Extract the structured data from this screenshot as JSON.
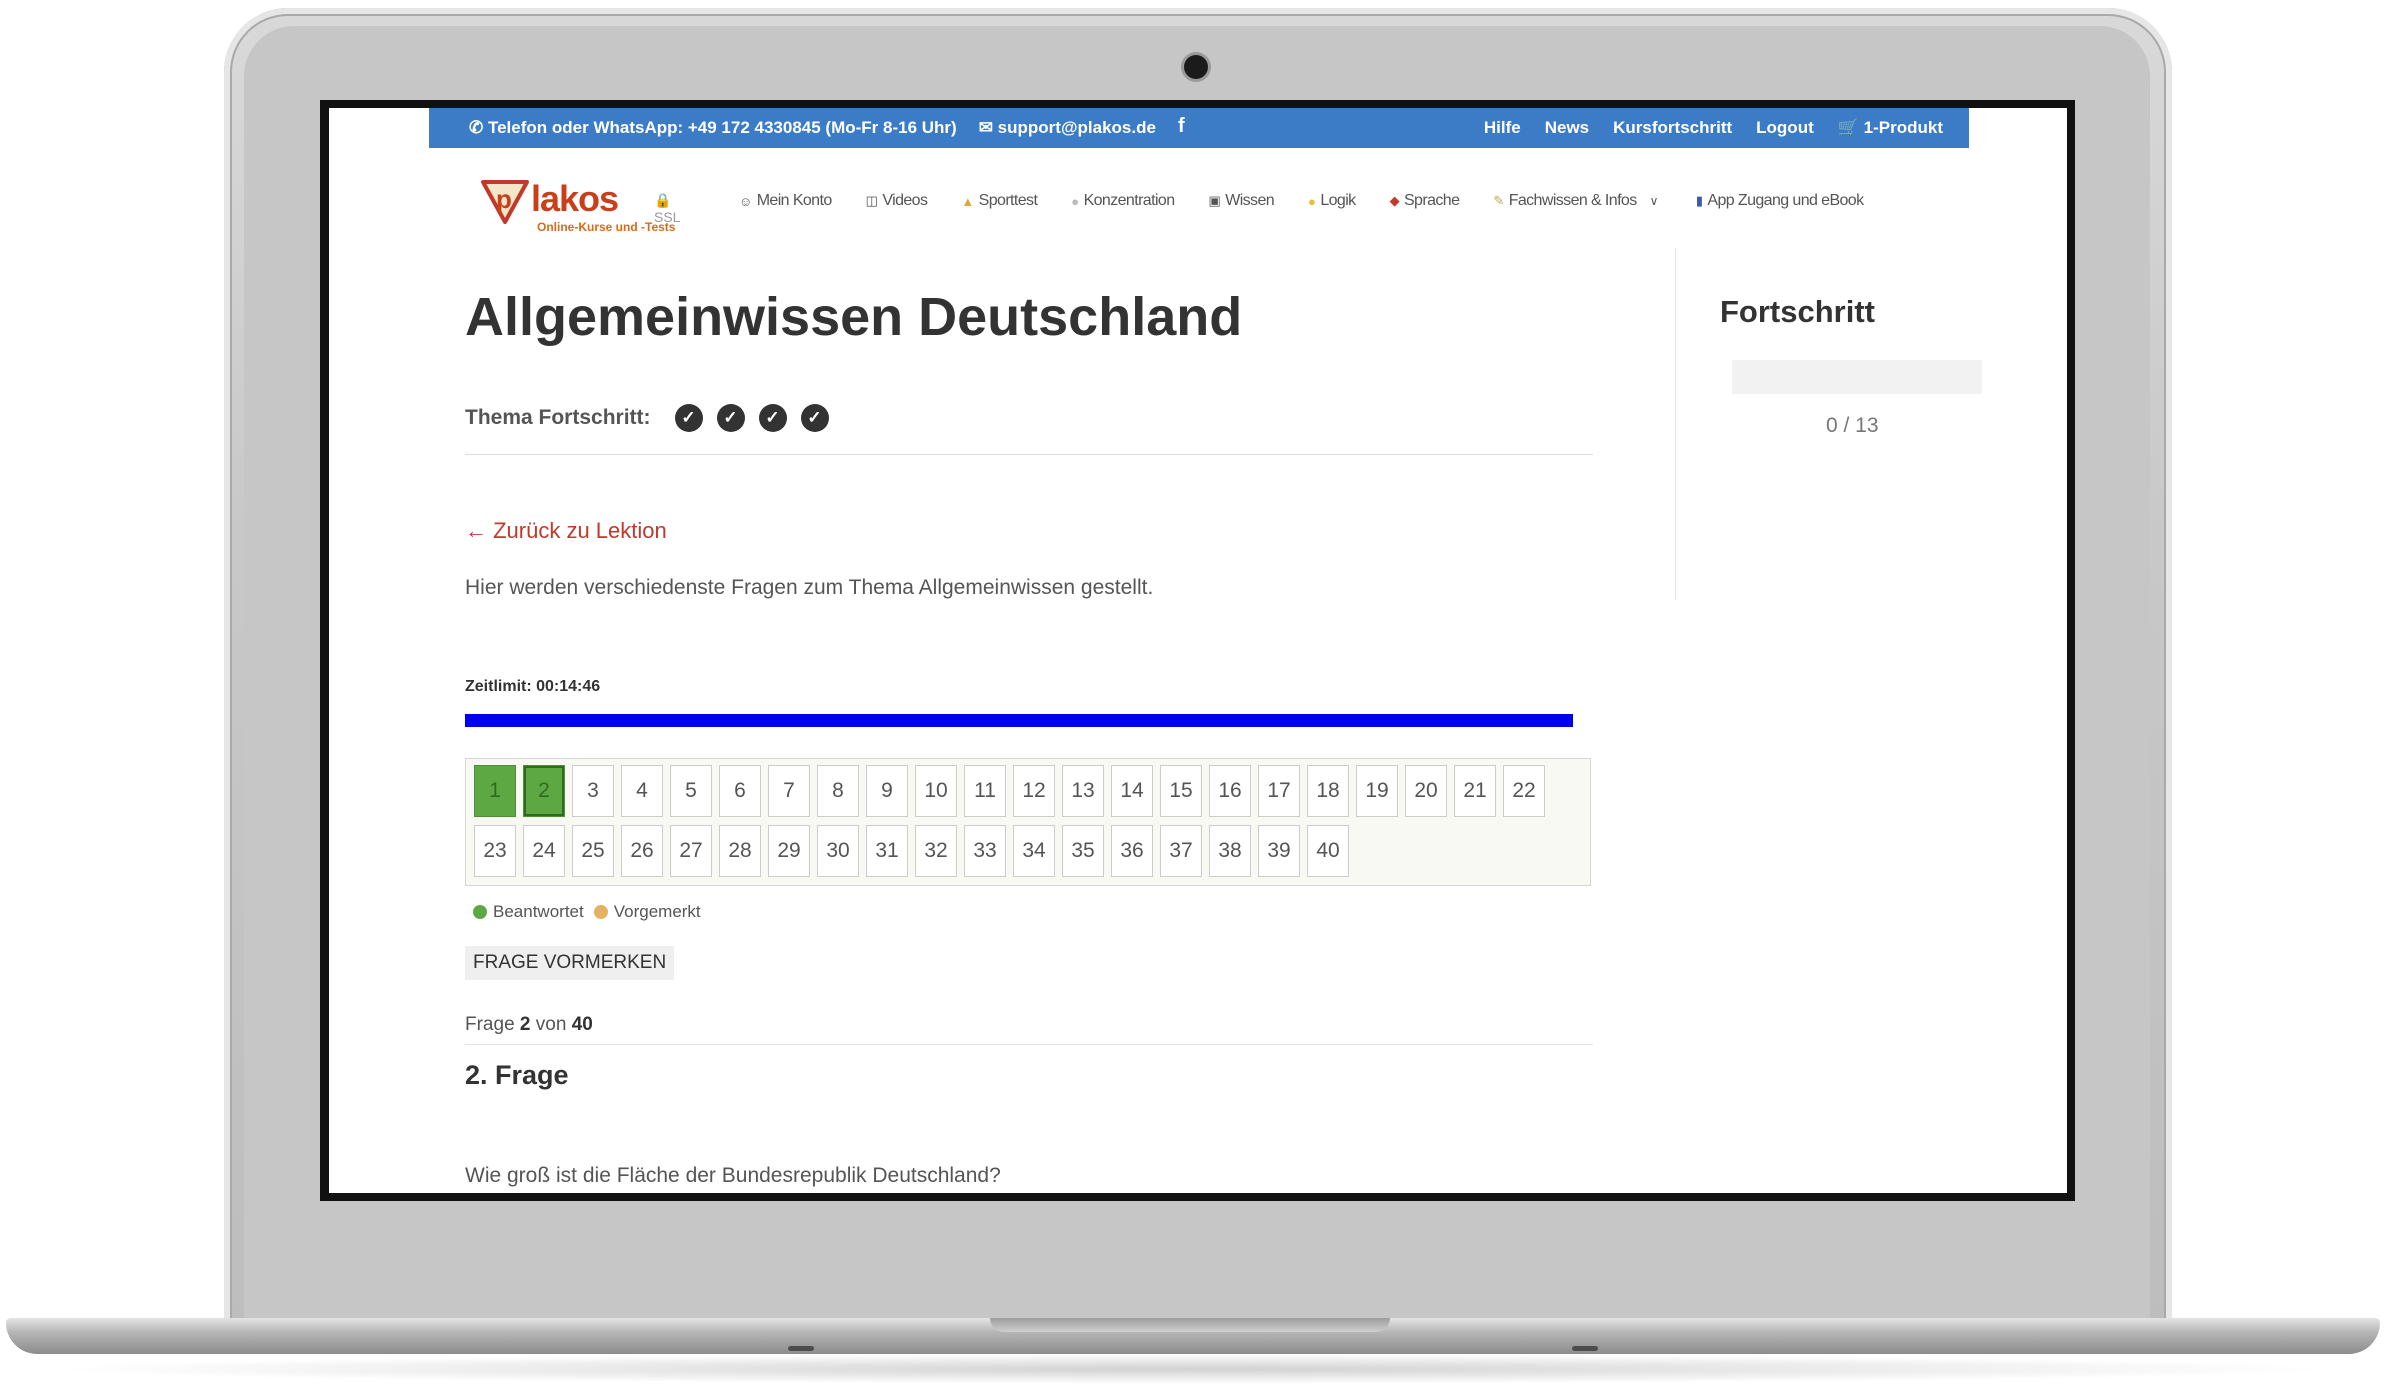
{
  "topbar": {
    "phone": "Telefon oder WhatsApp: +49 172 4330845 (Mo-Fr 8-16 Uhr)",
    "email": "support@plakos.de",
    "links": [
      "Hilfe",
      "News",
      "Kursfortschritt",
      "Logout",
      "1-Produkt"
    ]
  },
  "logo": {
    "word": "lakos",
    "ssl": "SSL",
    "tagline": "Online-Kurse und -Tests"
  },
  "nav": [
    {
      "label": "Mein Konto",
      "icon": "smiley-icon"
    },
    {
      "label": "Videos",
      "icon": "camera-icon"
    },
    {
      "label": "Sporttest",
      "icon": "muscle-icon"
    },
    {
      "label": "Konzentration",
      "icon": "speech-icon"
    },
    {
      "label": "Wissen",
      "icon": "book-icon"
    },
    {
      "label": "Logik",
      "icon": "bulb-icon"
    },
    {
      "label": "Sprache",
      "icon": "lips-icon"
    },
    {
      "label": "Fachwissen & Infos",
      "icon": "notepad-icon"
    },
    {
      "label": "App Zugang und eBook",
      "icon": "phone-icon"
    }
  ],
  "page": {
    "title": "Allgemeinwissen Deutschland",
    "thema_label": "Thema Fortschritt:",
    "back_link": "← Zurück zu Lektion",
    "description": "Hier werden verschiedenste Fragen zum Thema Allgemeinwissen gestellt.",
    "zeitlimit": "Zeitlimit: 00:14:46",
    "timer_fraction": 1.0
  },
  "questions": {
    "numbers": [
      "1",
      "2",
      "3",
      "4",
      "5",
      "6",
      "7",
      "8",
      "9",
      "10",
      "11",
      "12",
      "13",
      "14",
      "15",
      "16",
      "17",
      "18",
      "19",
      "20",
      "21",
      "22",
      "23",
      "24",
      "25",
      "26",
      "27",
      "28",
      "29",
      "30",
      "31",
      "32",
      "33",
      "34",
      "35",
      "36",
      "37",
      "38",
      "39",
      "40"
    ],
    "answered": [
      1,
      2
    ],
    "current": 2
  },
  "legend": {
    "answered": "Beantwortet",
    "marked": "Vorgemerkt",
    "answered_color": "#5ea843",
    "marked_color": "#e3b363"
  },
  "vormerken": "FRAGE VORMERKEN",
  "frage_counter": {
    "prefix": "Frage",
    "current": "2",
    "mid": "von",
    "total": "40"
  },
  "question_title": "2. Frage",
  "question_text": "Wie groß ist die Fläche der Bundesrepublik Deutschland?",
  "sidebar": {
    "title": "Fortschritt",
    "count": "0 / 13",
    "fraction": 0
  },
  "colors": {
    "topbar": "#3c7cc6",
    "link": "#c0392b",
    "timer": "#0000ee",
    "brand": "#c83f1a"
  }
}
